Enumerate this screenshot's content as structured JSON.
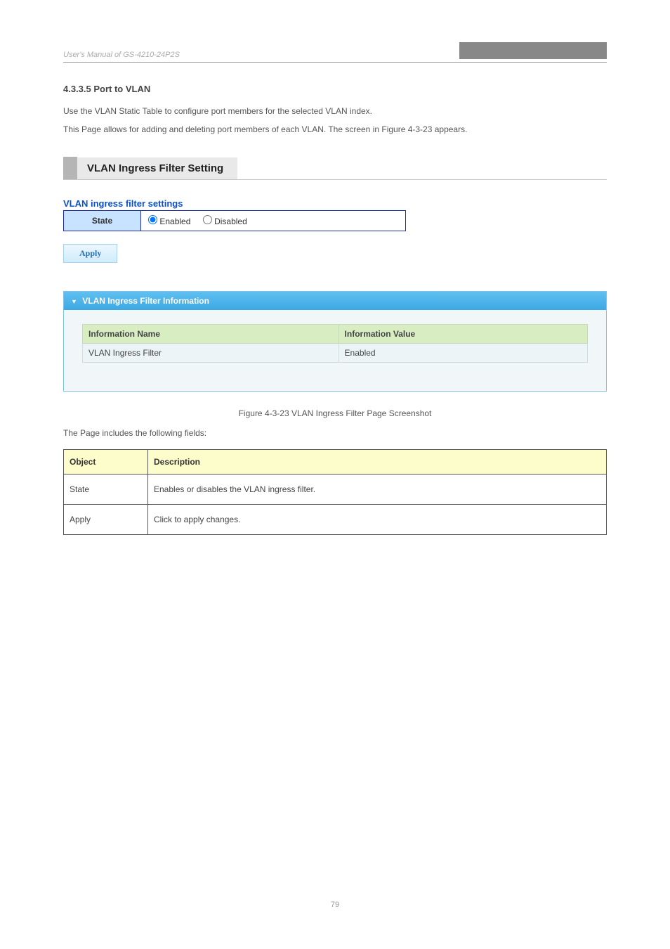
{
  "header": {
    "left": "User's Manual of GS-4210-24P2S",
    "right_placeholder": ""
  },
  "section": {
    "number": "4.3.3.5 Port to VLAN",
    "intro1": "Use the VLAN Static Table to configure port members for the selected VLAN index.",
    "intro2": "This Page allows for adding and deleting port members of each VLAN. The screen in Figure 4-3-23 appears.",
    "caption_figure": "Figure 4-3-23 VLAN Ingress Filter Page Screenshot",
    "caption_desc": "The Page includes the following fields:"
  },
  "screenshot": {
    "title": "VLAN Ingress Filter Setting",
    "sub_heading": "VLAN ingress filter settings",
    "state_label": "State",
    "radio_enabled": "Enabled",
    "radio_disabled": "Disabled",
    "apply_label": "Apply",
    "info_header": "VLAN Ingress Filter Information",
    "info_cols": {
      "name": "Information Name",
      "value": "Information Value"
    },
    "info_row": {
      "name": "VLAN Ingress Filter",
      "value": "Enabled"
    }
  },
  "desc_table": {
    "head_object": "Object",
    "head_desc": "Description",
    "rows": [
      {
        "object": "State",
        "desc": "Enables or disables the VLAN ingress filter."
      },
      {
        "object": "Apply",
        "desc": "Click to apply changes."
      }
    ]
  },
  "footer": "79"
}
